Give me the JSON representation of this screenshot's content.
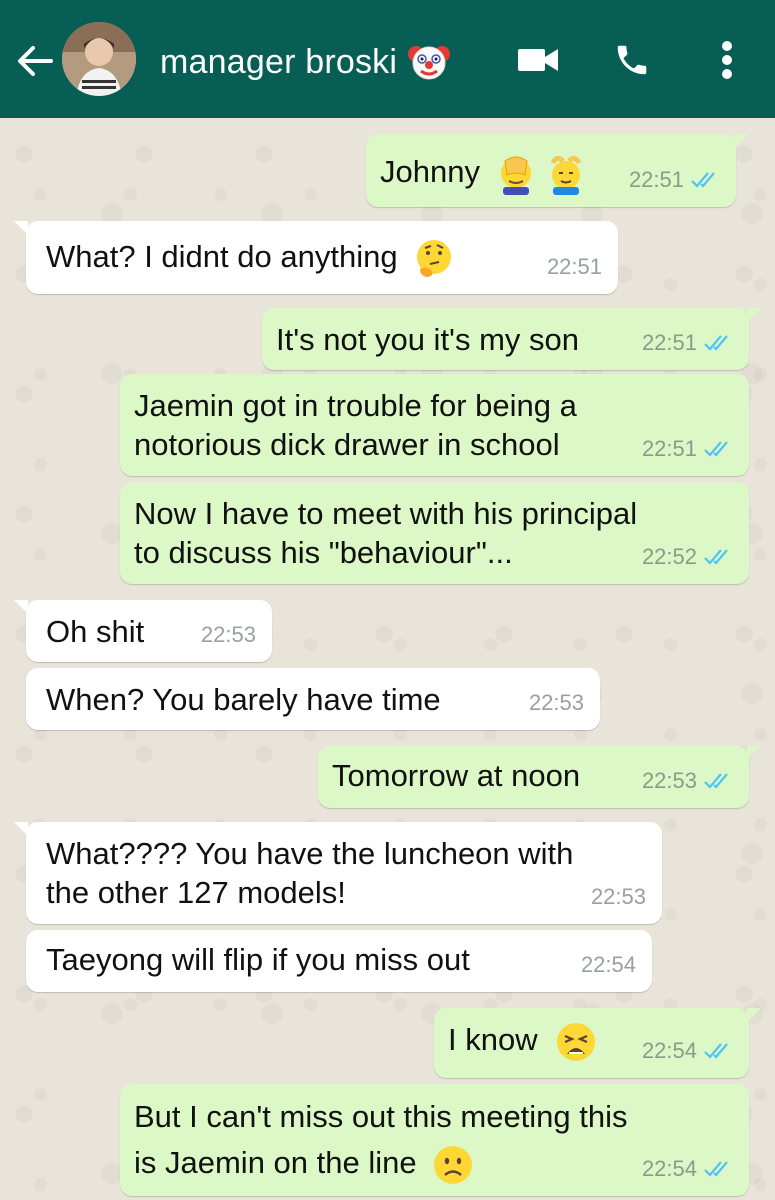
{
  "header": {
    "contact_name": "manager broski",
    "contact_emoji": "clown-face",
    "icons": [
      "back-arrow-icon",
      "video-call-icon",
      "phone-icon",
      "more-vert-icon"
    ]
  },
  "colors": {
    "header": "#075e54",
    "outgoing": "#dcf8c6",
    "incoming": "#ffffff",
    "read_ticks": "#4fc3f7"
  },
  "messages": [
    {
      "dir": "out",
      "lines": [
        "Johnny"
      ],
      "emojis": [
        "face-palm",
        "face-massage"
      ],
      "time": "22:51",
      "status": "read"
    },
    {
      "dir": "in",
      "lines": [
        "What? I didnt do anything"
      ],
      "emojis": [
        "thinking-face"
      ],
      "time": "22:51"
    },
    {
      "dir": "out",
      "lines": [
        "It's not you it's my son"
      ],
      "time": "22:51",
      "status": "read"
    },
    {
      "dir": "out",
      "lines": [
        "Jaemin got in trouble for being a",
        "notorious dick drawer in school"
      ],
      "time": "22:51",
      "status": "read"
    },
    {
      "dir": "out",
      "lines": [
        "Now I have to meet with his principal",
        "to discuss his \"behaviour\"..."
      ],
      "time": "22:52",
      "status": "read"
    },
    {
      "dir": "in",
      "lines": [
        "Oh shit"
      ],
      "time": "22:53"
    },
    {
      "dir": "in",
      "lines": [
        "When? You barely have time"
      ],
      "time": "22:53"
    },
    {
      "dir": "out",
      "lines": [
        "Tomorrow at noon"
      ],
      "time": "22:53",
      "status": "read"
    },
    {
      "dir": "in",
      "lines": [
        "What???? You have the luncheon with",
        "the other 127 models!"
      ],
      "time": "22:53"
    },
    {
      "dir": "in",
      "lines": [
        "Taeyong will flip if you miss out"
      ],
      "time": "22:54"
    },
    {
      "dir": "out",
      "lines": [
        "I know"
      ],
      "emojis": [
        "tired-face"
      ],
      "time": "22:54",
      "status": "read"
    },
    {
      "dir": "out",
      "lines": [
        "But I can't miss out this meeting this",
        "is Jaemin on the line"
      ],
      "emojis": [
        "frowning-face"
      ],
      "time": "22:54",
      "status": "read"
    }
  ]
}
